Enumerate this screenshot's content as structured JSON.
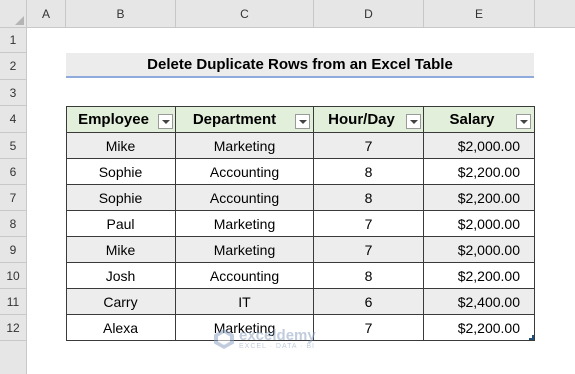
{
  "column_headers": [
    "A",
    "B",
    "C",
    "D",
    "E"
  ],
  "row_headers": [
    "1",
    "2",
    "3",
    "4",
    "5",
    "6",
    "7",
    "8",
    "9",
    "10",
    "11",
    "12"
  ],
  "title": "Delete Duplicate Rows from an Excel Table",
  "table": {
    "headers": [
      "Employee",
      "Department",
      "Hour/Day",
      "Salary"
    ],
    "rows": [
      [
        "Mike",
        "Marketing",
        "7",
        "$2,000.00"
      ],
      [
        "Sophie",
        "Accounting",
        "8",
        "$2,200.00"
      ],
      [
        "Sophie",
        "Accounting",
        "8",
        "$2,200.00"
      ],
      [
        "Paul",
        "Marketing",
        "7",
        "$2,000.00"
      ],
      [
        "Mike",
        "Marketing",
        "7",
        "$2,000.00"
      ],
      [
        "Josh",
        "Accounting",
        "8",
        "$2,200.00"
      ],
      [
        "Carry",
        "IT",
        "6",
        "$2,400.00"
      ],
      [
        "Alexa",
        "Marketing",
        "7",
        "$2,200.00"
      ]
    ]
  },
  "watermark": {
    "name": "exceldemy",
    "tagline": "EXCEL · DATA · BI"
  },
  "colors": {
    "header_fill": "#e2efda",
    "banded_fill": "#ededed",
    "title_underline": "#8faadc"
  },
  "icons": {
    "filter": "chevron-down-icon",
    "watermark_logo": "exceldemy-logo-icon"
  }
}
